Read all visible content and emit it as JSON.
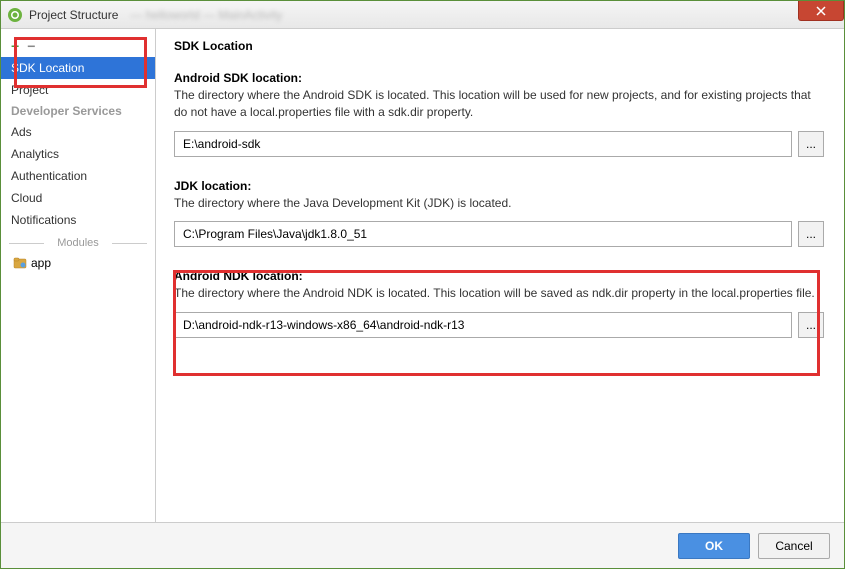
{
  "window": {
    "title": "Project Structure",
    "blur_text": "— helloworld — MainActivity"
  },
  "sidebar": {
    "items": [
      {
        "label": "SDK Location",
        "selected": true
      },
      {
        "label": "Project",
        "selected": false
      }
    ],
    "dev_services_heading": "Developer Services",
    "dev_services": [
      {
        "label": "Ads"
      },
      {
        "label": "Analytics"
      },
      {
        "label": "Authentication"
      },
      {
        "label": "Cloud"
      },
      {
        "label": "Notifications"
      }
    ],
    "modules_heading": "Modules",
    "modules": [
      {
        "label": "app"
      }
    ]
  },
  "content": {
    "page_title": "SDK Location",
    "sdk": {
      "heading": "Android SDK location:",
      "desc": "The directory where the Android SDK is located. This location will be used for new projects, and for existing projects that do not have a local.properties file with a sdk.dir property.",
      "value": "E:\\android-sdk"
    },
    "jdk": {
      "heading": "JDK location:",
      "desc": "The directory where the Java Development Kit (JDK) is located.",
      "value": "C:\\Program Files\\Java\\jdk1.8.0_51"
    },
    "ndk": {
      "heading": "Android NDK location:",
      "desc": "The directory where the Android NDK is located. This location will be saved as ndk.dir property in the local.properties file.",
      "value": "D:\\android-ndk-r13-windows-x86_64\\android-ndk-r13"
    },
    "browse_label": "..."
  },
  "footer": {
    "ok": "OK",
    "cancel": "Cancel"
  }
}
